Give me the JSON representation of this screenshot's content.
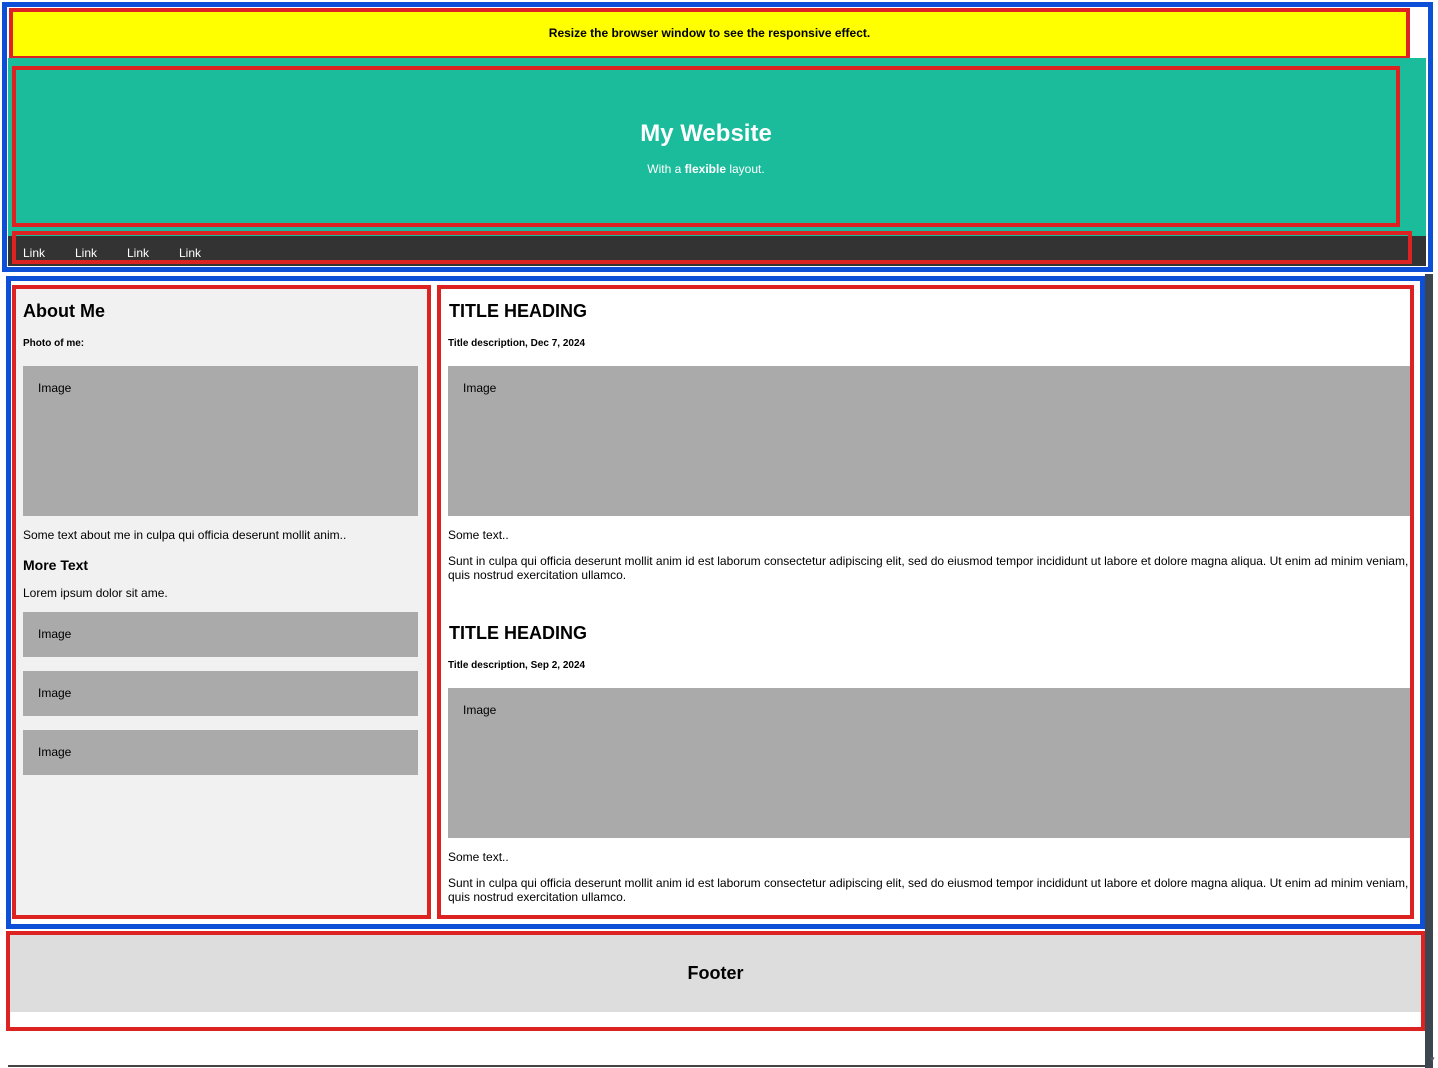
{
  "banner": {
    "text": "Resize the browser window to see the responsive effect."
  },
  "header": {
    "title": "My Website",
    "subtitle_prefix": "With a ",
    "subtitle_bold": "flexible",
    "subtitle_suffix": " layout."
  },
  "nav": {
    "links": [
      "Link",
      "Link",
      "Link",
      "Link"
    ]
  },
  "side": {
    "heading": "About Me",
    "photo_label": "Photo of me:",
    "image_label": "Image",
    "about_text": "Some text about me in culpa qui officia deserunt mollit anim..",
    "more_heading": "More Text",
    "more_text": "Lorem ipsum dolor sit ame.",
    "small_images": [
      "Image",
      "Image",
      "Image"
    ]
  },
  "main": {
    "posts": [
      {
        "title": "TITLE HEADING",
        "description": "Title description, Dec 7, 2024",
        "image_label": "Image",
        "short_text": "Some text..",
        "body": "Sunt in culpa qui officia deserunt mollit anim id est laborum consectetur adipiscing elit, sed do eiusmod tempor incididunt ut labore et dolore magna aliqua. Ut enim ad minim veniam, quis nostrud exercitation ullamco."
      },
      {
        "title": "TITLE HEADING",
        "description": "Title description, Sep 2, 2024",
        "image_label": "Image",
        "short_text": "Some text..",
        "body": "Sunt in culpa qui officia deserunt mollit anim id est laborum consectetur adipiscing elit, sed do eiusmod tempor incididunt ut labore et dolore magna aliqua. Ut enim ad minim veniam, quis nostrud exercitation ullamco."
      }
    ]
  },
  "footer": {
    "text": "Footer"
  },
  "colors": {
    "banner": "#ffff00",
    "header": "#1abc9c",
    "navbar": "#333333",
    "side": "#f1f1f1",
    "image_placeholder": "#aaaaaa",
    "footer": "#dddddd",
    "outline_blue": "#0d4fd6",
    "outline_red": "#dd2222"
  }
}
